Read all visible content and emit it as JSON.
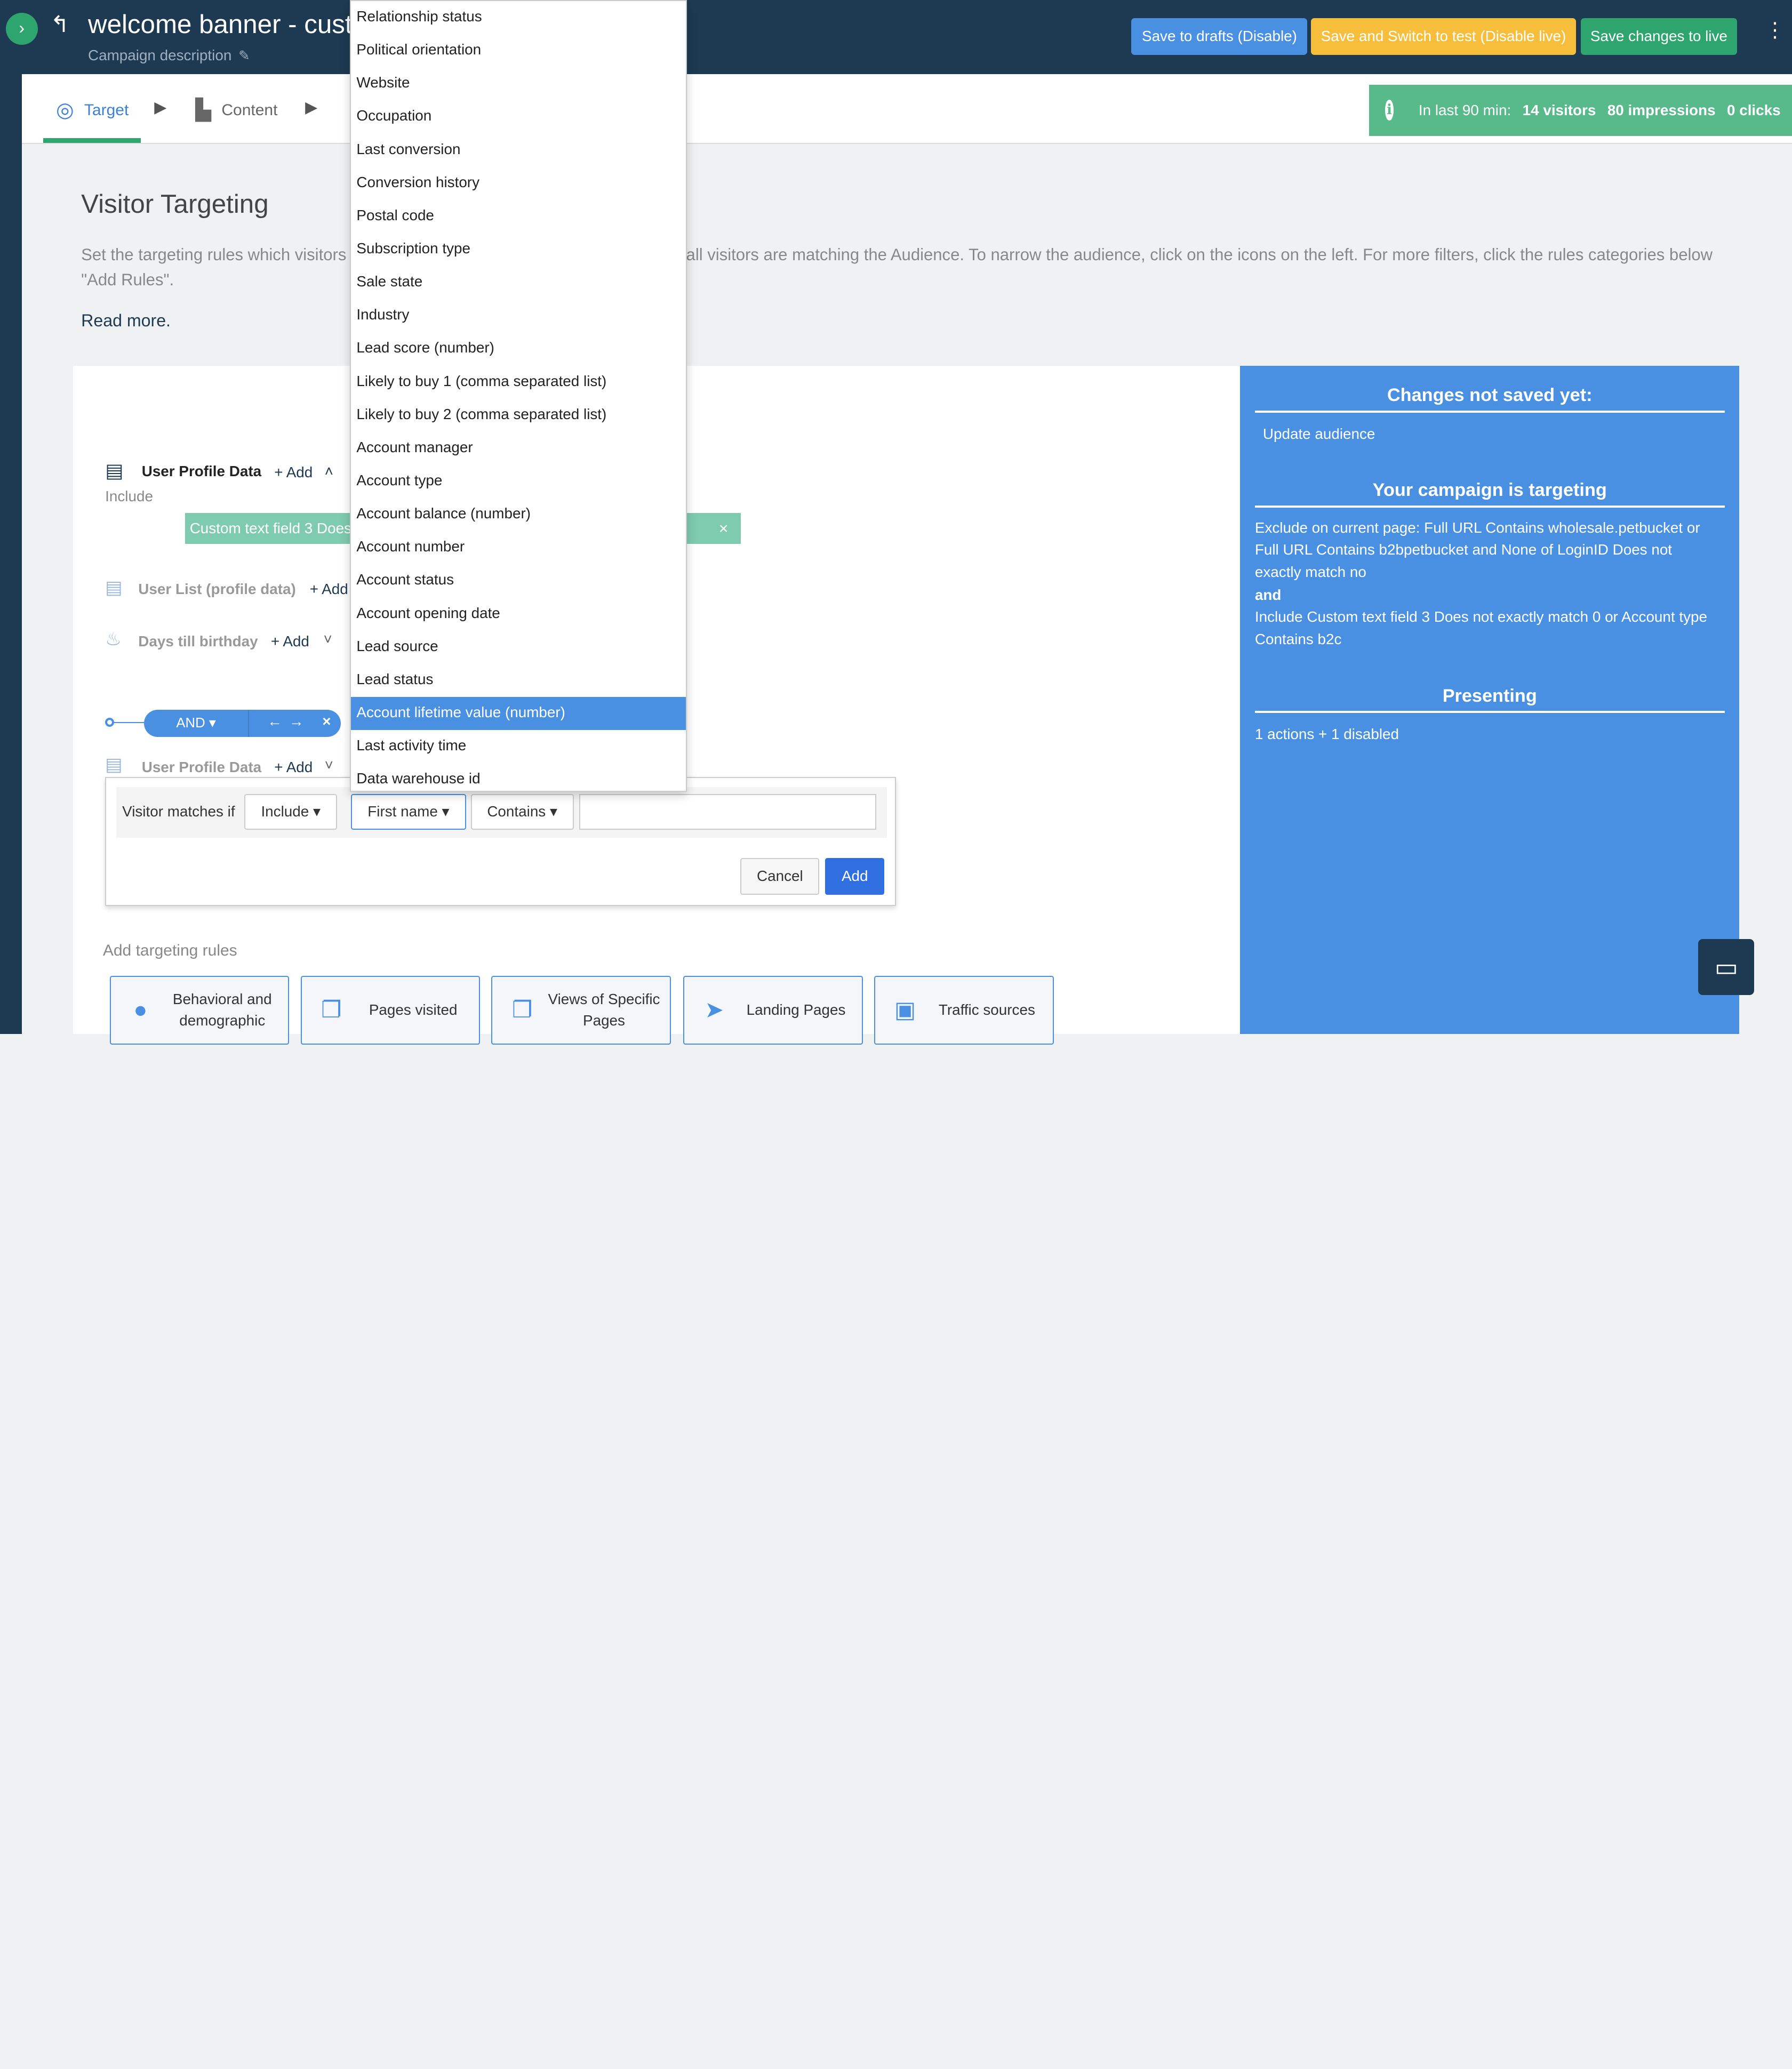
{
  "header": {
    "title": "welcome banner - custom",
    "description": "Campaign description",
    "buttons": {
      "drafts": "Save to drafts (Disable)",
      "test": "Save and Switch to test (Disable live)",
      "live": "Save changes to live"
    },
    "kebab": "⋮"
  },
  "tabs": [
    {
      "label": "Target"
    },
    {
      "label": "Content"
    }
  ],
  "stats": {
    "prefix": "In last 90 min:",
    "visitors": "14 visitors",
    "impressions": "80 impressions",
    "clicks": "0 clicks"
  },
  "targeting": {
    "title": "Visitor Targeting",
    "description": "Set the targeting rules which visitors should see the campaign content. By default, all visitors are matching the Audience. To narrow the audience, click on the icons on the left. For more filters, click the rules categories below \"Add Rules\".",
    "read_more": "Read more."
  },
  "rules": {
    "row1": {
      "label": "User Profile Data",
      "add": "+ Add",
      "include": "Include",
      "chip": "Custom text field 3 Does not exactly match 0 or Account type Contains b2c"
    },
    "row2": {
      "label": "User List (profile data)",
      "add": "+ Add"
    },
    "row3": {
      "label": "Days till birthday",
      "add": "+ Add"
    },
    "and_label": "AND",
    "row4": {
      "label": "User Profile Data",
      "add": "+ Add"
    }
  },
  "editor": {
    "visitor_matches": "Visitor matches if",
    "include": "Include",
    "field": "First name",
    "operator": "Contains",
    "value": "",
    "cancel": "Cancel",
    "add": "Add"
  },
  "add_rules": {
    "title": "Add targeting rules",
    "cards": [
      {
        "label": "Behavioral and demographic",
        "icon": "person-icon"
      },
      {
        "label": "Pages visited",
        "icon": "pages-icon"
      },
      {
        "label": "Views of Specific Pages",
        "icon": "pages-icon"
      },
      {
        "label": "Landing Pages",
        "icon": "paper-plane-icon"
      },
      {
        "label": "Traffic sources",
        "icon": "bus-icon"
      }
    ]
  },
  "side_panel": {
    "unsaved_title": "Changes not saved yet:",
    "unsaved_item": "Update audience",
    "targeting_title": "Your campaign is targeting",
    "targeting_text1": "Exclude on current page: Full URL Contains wholesale.petbucket or Full URL Contains b2bpetbucket and None of LoginID Does not exactly match no",
    "targeting_and": "and",
    "targeting_text2": "Include Custom text field 3 Does not exactly match 0 or Account type Contains b2c",
    "presenting_title": "Presenting",
    "presenting_text": "1 actions + 1 disabled"
  },
  "dropdown": {
    "items": [
      "Relationship status",
      "Political orientation",
      "Website",
      "Occupation",
      "Last conversion",
      "Conversion history",
      "Postal code",
      "Subscription type",
      "Sale state",
      "Industry",
      "Lead score (number)",
      "Likely to buy 1 (comma separated list)",
      "Likely to buy 2 (comma separated list)",
      "Account manager",
      "Account type",
      "Account balance (number)",
      "Account number",
      "Account status",
      "Account opening date",
      "Lead source",
      "Lead status",
      "Account lifetime value (number)",
      "Last activity time",
      "Data warehouse id"
    ],
    "highlighted": "Account lifetime value (number)"
  },
  "colors": {
    "navy": "#1d3a52",
    "green": "#2ea56e",
    "blue": "#4a90e2",
    "yellow": "#f6be3b"
  }
}
